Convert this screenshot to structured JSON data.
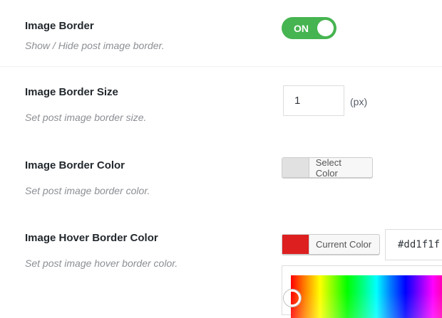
{
  "settings": [
    {
      "label": "Image Border",
      "desc": "Show / Hide post image border.",
      "toggle": "ON"
    },
    {
      "label": "Image Border Size",
      "desc": "Set post image border size.",
      "value": "1",
      "unit": "(px)"
    },
    {
      "label": "Image Border Color",
      "desc": "Set post image border color.",
      "button": "Select Color",
      "swatch": "#e1e1e1"
    },
    {
      "label": "Image Hover Border Color",
      "desc": "Set post image hover border color.",
      "button": "Current Color",
      "swatch": "#dd1f1f",
      "hex": "#dd1f1f"
    }
  ],
  "colors": {
    "toggle_on": "#46b450",
    "current_color": "#dd1f1f"
  }
}
